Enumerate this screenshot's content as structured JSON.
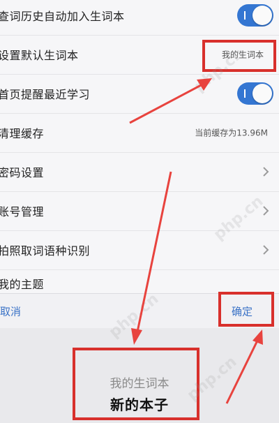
{
  "settings": {
    "rows": [
      {
        "label": "查词历史自动加入生词本",
        "control": "toggle",
        "on": true
      },
      {
        "label": "设置默认生词本",
        "value": "我的生词本"
      },
      {
        "label": "首页提醒最近学习",
        "control": "toggle",
        "on": true
      },
      {
        "label": "清理缓存",
        "value": "当前缓存为13.96M"
      },
      {
        "label": "密码设置",
        "control": "chevron"
      },
      {
        "label": "账号管理",
        "control": "chevron"
      },
      {
        "label": "拍照取词语种识别",
        "control": "chevron"
      },
      {
        "label": "我的主题"
      }
    ]
  },
  "picker": {
    "cancel_label": "取消",
    "confirm_label": "确定",
    "options": [
      "我的生词本",
      "新的本子"
    ],
    "selected": "新的本子"
  },
  "watermark": "php.cn",
  "colors": {
    "accent": "#3476d2",
    "annotation": "#d8302c",
    "link": "#3a72c6"
  }
}
